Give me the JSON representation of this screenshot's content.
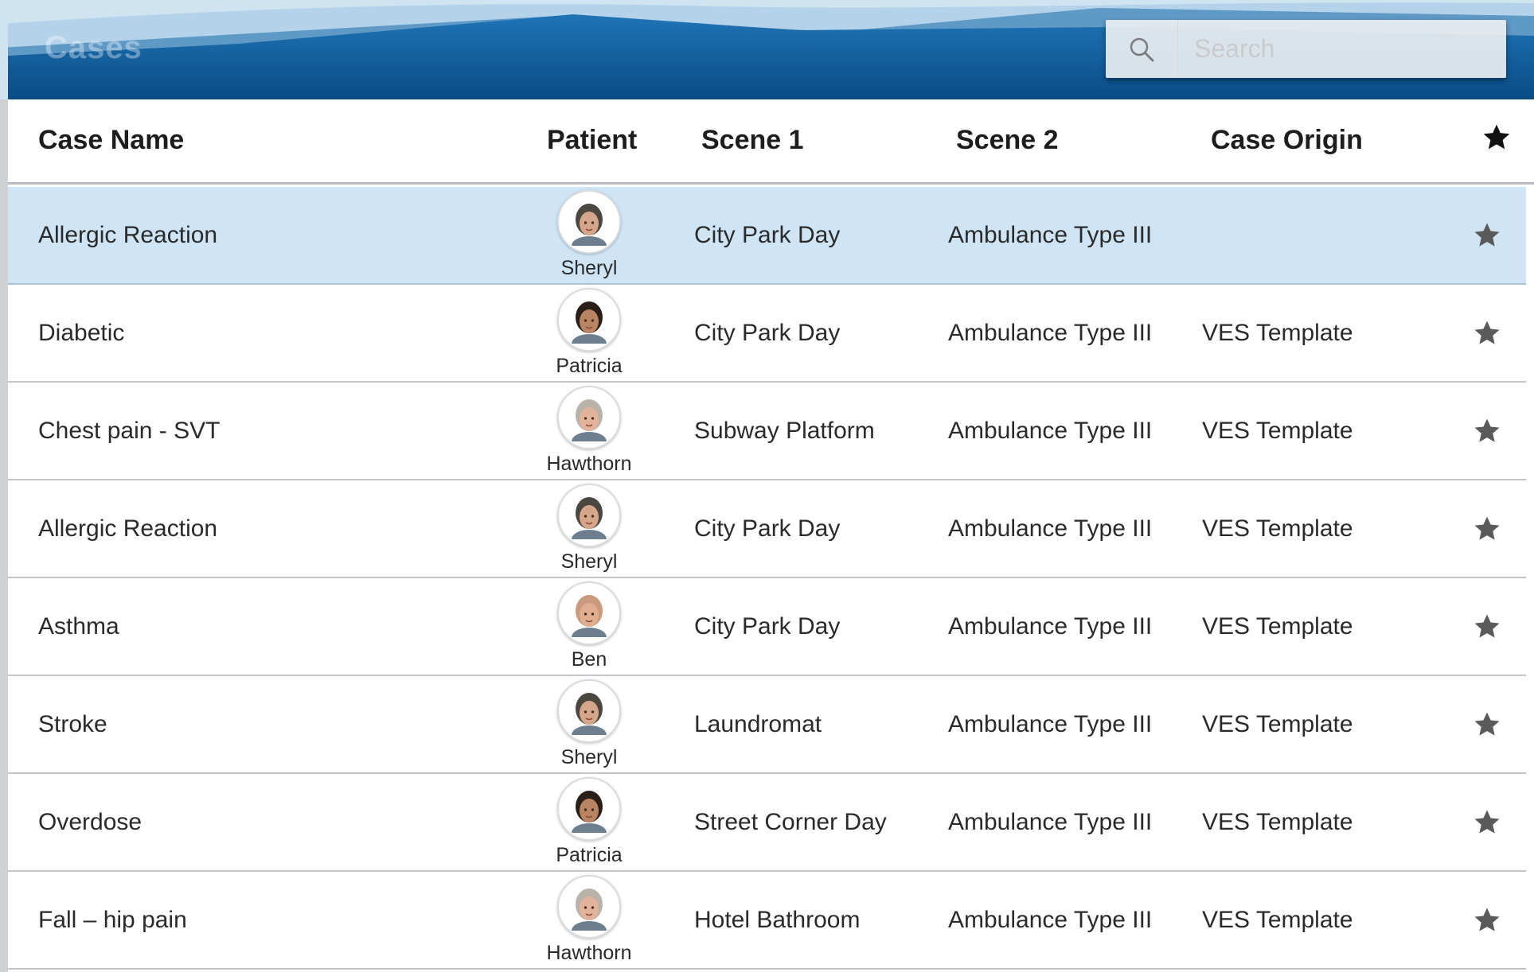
{
  "header": {
    "title": "Cases",
    "search_placeholder": "Search"
  },
  "colors": {
    "header_dark": "#0a4f8a",
    "header_mid": "#1d6fb0",
    "header_light": "#cfe3f1",
    "selected_row": "#cfe5f5",
    "star": "#5a5a5a"
  },
  "table": {
    "columns": {
      "case_name": "Case Name",
      "patient": "Patient",
      "scene1": "Scene 1",
      "scene2": "Scene 2",
      "case_origin": "Case Origin",
      "favorite_icon": "star-icon"
    },
    "rows": [
      {
        "case_name": "Allergic Reaction",
        "patient": "Sheryl",
        "scene1": "City Park Day",
        "scene2": "Ambulance Type III",
        "case_origin": "",
        "selected": true
      },
      {
        "case_name": "Diabetic",
        "patient": "Patricia",
        "scene1": "City Park Day",
        "scene2": "Ambulance Type III",
        "case_origin": "VES Template"
      },
      {
        "case_name": "Chest pain - SVT",
        "patient": "Hawthorn",
        "scene1": "Subway Platform",
        "scene2": "Ambulance Type III",
        "case_origin": "VES Template"
      },
      {
        "case_name": "Allergic Reaction",
        "patient": "Sheryl",
        "scene1": "City Park Day",
        "scene2": "Ambulance Type III",
        "case_origin": "VES Template"
      },
      {
        "case_name": "Asthma",
        "patient": "Ben",
        "scene1": "City Park Day",
        "scene2": "Ambulance Type III",
        "case_origin": "VES Template"
      },
      {
        "case_name": "Stroke",
        "patient": "Sheryl",
        "scene1": "Laundromat",
        "scene2": "Ambulance Type III",
        "case_origin": "VES Template"
      },
      {
        "case_name": "Overdose",
        "patient": "Patricia",
        "scene1": "Street Corner Day",
        "scene2": "Ambulance Type III",
        "case_origin": "VES Template"
      },
      {
        "case_name": "Fall – hip pain",
        "patient": "Hawthorn",
        "scene1": "Hotel Bathroom",
        "scene2": "Ambulance Type III",
        "case_origin": "VES Template"
      }
    ]
  }
}
